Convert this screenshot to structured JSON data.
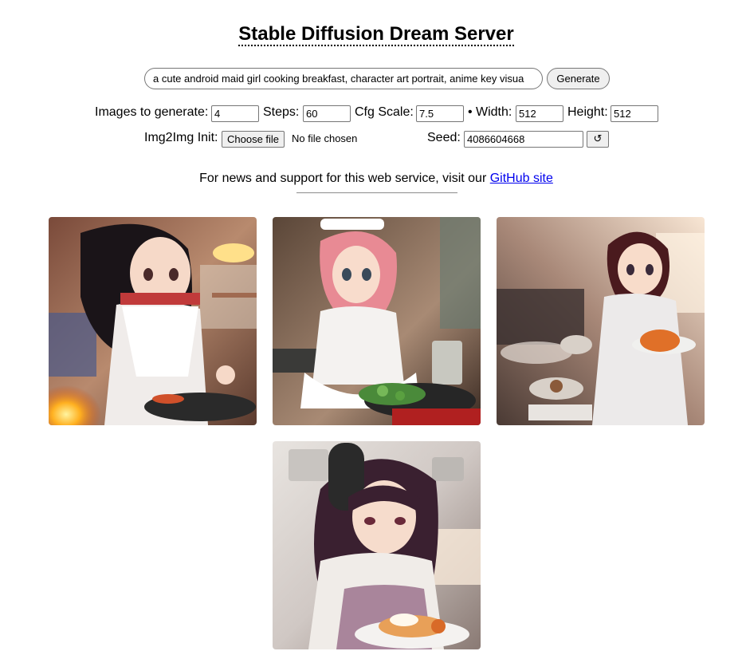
{
  "header": {
    "title": "Stable Diffusion Dream Server"
  },
  "prompt": {
    "value": "a cute android maid girl cooking breakfast, character art portrait, anime key visua",
    "generate_label": "Generate"
  },
  "settings": {
    "images_label": "Images to generate:",
    "images_value": "4",
    "steps_label": "Steps:",
    "steps_value": "60",
    "cfg_label": "Cfg Scale:",
    "cfg_value": "7.5",
    "bullet": "•",
    "width_label": "Width:",
    "width_value": "512",
    "height_label": "Height:",
    "height_value": "512",
    "img2img_label": "Img2Img Init:",
    "choose_file_label": "Choose file",
    "no_file_label": "No file chosen",
    "seed_label": "Seed:",
    "seed_value": "4086604668",
    "reseed_label": "↺"
  },
  "news": {
    "text": "For news and support for this web service, visit our",
    "link_text": "GitHub site"
  },
  "results": {
    "images": [
      {
        "description": "anime chef girl with dark hair cooking over flaming pan in kitchen"
      },
      {
        "description": "anime maid girl with pink hair cooking greens in a wok"
      },
      {
        "description": "anime girl with short dark hair holding plate of omelette in sunlit kitchen"
      },
      {
        "description": "anime girl with long dark hair and headphones holding plate of food"
      }
    ]
  }
}
